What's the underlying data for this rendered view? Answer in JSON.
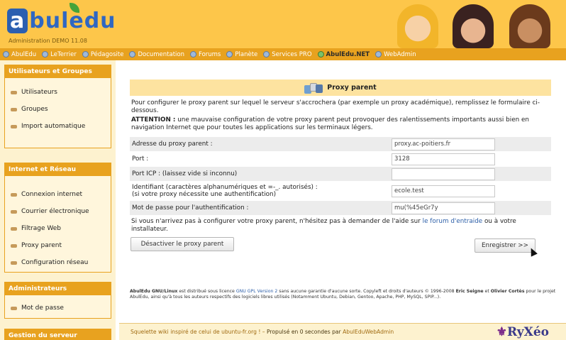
{
  "header": {
    "logo_text": "abuledu",
    "subtitle": "Administration DEMO 11.08"
  },
  "nav": [
    {
      "label": "AbulEdu",
      "bold": false
    },
    {
      "label": "LeTerrier",
      "bold": false
    },
    {
      "label": "Pédagosite",
      "bold": false
    },
    {
      "label": "Documentation",
      "bold": false
    },
    {
      "label": "Forums",
      "bold": false
    },
    {
      "label": "Planète",
      "bold": false
    },
    {
      "label": "Services PRO",
      "bold": false
    },
    {
      "label": "AbulEdu.NET",
      "bold": true
    },
    {
      "label": "WebAdmin",
      "bold": false
    }
  ],
  "sidebar": {
    "sections": [
      {
        "title": "Utilisateurs et Groupes",
        "items": [
          "Utilisateurs",
          "Groupes",
          "Import automatique"
        ]
      },
      {
        "title": "Internet et Réseau",
        "items": [
          "Connexion internet",
          "Courrier électronique",
          "Filtrage Web",
          "Proxy parent",
          "Configuration réseau"
        ]
      },
      {
        "title": "Administrateurs",
        "items": [
          "Mot de passe"
        ]
      },
      {
        "title": "Gestion du serveur",
        "items": []
      }
    ]
  },
  "main": {
    "title": "Proxy parent",
    "intro": "Pour configurer le proxy parent sur lequel le serveur s'accrochera (par exemple un proxy académique), remplissez le formulaire ci-dessous.",
    "warning_label": "ATTENTION :",
    "warning_text": " une mauvaise configuration de votre proxy parent peut provoquer des ralentissements importants aussi bien en navigation Internet que pour toutes les applications sur les terminaux légers.",
    "fields": [
      {
        "label": "Adresse du proxy parent :",
        "value": "proxy.ac-poitiers.fr"
      },
      {
        "label": "Port :",
        "value": "3128"
      },
      {
        "label": "Port ICP : (laissez vide si inconnu)",
        "value": ""
      },
      {
        "label": "Identifiant (caractères alphanumériques et =-_. autorisés) :",
        "label2": "(si votre proxy nécessite une authentification)",
        "value": "ecole.test"
      },
      {
        "label": "Mot de passe pour l'authentification :",
        "value": "mu(%45eGr7y"
      }
    ],
    "help_text": "Si vous n'arrivez pas à configurer votre proxy parent, n'hésitez pas à demander de l'aide sur ",
    "help_link": "le forum d'entraide",
    "help_after": " ou à votre installateur.",
    "disable_button": "Désactiver le proxy parent",
    "save_button": "Enregistrer >>"
  },
  "license": {
    "product": "AbulEdu GNU/Linux",
    "text1": " est distribué sous licence ",
    "link": "GNU GPL Version 2",
    "text2": " sans aucune garantie d'aucune sorte. Copyleft et droits d'auteurs © 1996-2008 ",
    "author1": "Eric Seigne",
    "text3": " et ",
    "author2": "Olivier Cortès",
    "text4": " pour le projet AbulEdu, ainsi qu'à tous les auteurs respectifs des logiciels libres utilisés (Notamment Ubuntu, Debian, Gentoo, Apache, PHP, MySQL, SPIP...)."
  },
  "footer": {
    "left": "Squelette wiki inspiré de celui de ubuntu-fr.org ! – ",
    "middle": "Propulsé en 0 secondes par ",
    "right": "AbulEduWebAdmin",
    "logo": "RyXéo"
  },
  "colors": {
    "header_bg": "#fdc64a",
    "nav_bg": "#e8a21f",
    "sidebar_bg": "#fdf2cf",
    "title_bar": "#fde3a0",
    "link": "#2d5fa8"
  }
}
